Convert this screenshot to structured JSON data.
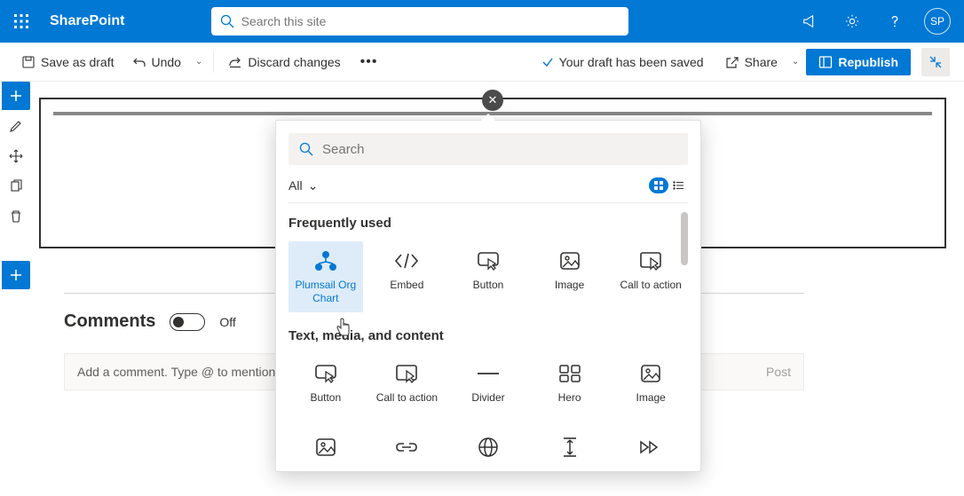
{
  "header": {
    "app_name": "SharePoint",
    "search_placeholder": "Search this site",
    "avatar_text": "SP"
  },
  "commands": {
    "save_draft": "Save as draft",
    "undo": "Undo",
    "discard": "Discard changes",
    "saved_status": "Your draft has been saved",
    "share": "Share",
    "republish": "Republish"
  },
  "comments": {
    "title": "Comments",
    "toggle_state": "Off",
    "placeholder": "Add a comment. Type @ to mention",
    "post_label": "Post"
  },
  "picker": {
    "search_placeholder": "Search",
    "filter_label": "All",
    "sections": {
      "freq": {
        "title": "Frequently used",
        "items": [
          "Plumsail Org Chart",
          "Embed",
          "Button",
          "Image",
          "Call to action"
        ]
      },
      "text": {
        "title": "Text, media, and content",
        "items": [
          "Button",
          "Call to action",
          "Divider",
          "Hero",
          "Image"
        ]
      }
    }
  }
}
